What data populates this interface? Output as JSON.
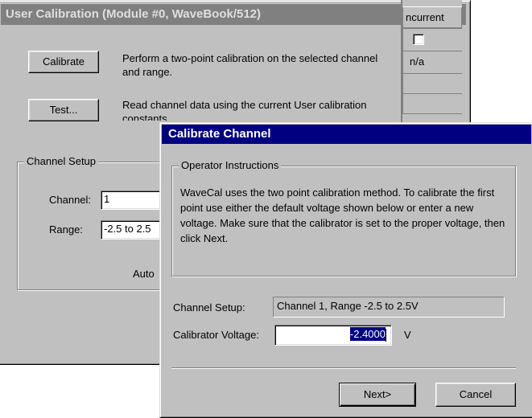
{
  "bg_window": {
    "title": "User Calibration (Module #0, WaveBook/512)",
    "calibrate_button": "Calibrate",
    "calibrate_desc": "Perform a two-point calibration on the selected channel and range.",
    "test_button": "Test...",
    "test_desc": "Read channel data using the current User calibration constants.",
    "channel_setup_title": "Channel Setup",
    "channel_label": "Channel:",
    "channel_value": "1",
    "range_label": "Range:",
    "range_value": "-2.5 to 2.5",
    "auto_label": "Auto",
    "table": {
      "header": "ncurrent",
      "row2_value": "n/a"
    }
  },
  "dialog": {
    "title": "Calibrate Channel",
    "group_title": "Operator Instructions",
    "instructions": "WaveCal uses the two point calibration method.  To calibrate the first point use either the default voltage shown below or enter a new voltage.  Make sure that the calibrator is set to the proper voltage, then click Next.",
    "channel_setup_label": "Channel Setup:",
    "channel_setup_value": "Channel 1,  Range -2.5 to 2.5V",
    "voltage_label": "Calibrator Voltage:",
    "voltage_value": "-2.4000",
    "voltage_unit": "V",
    "next_button": "Next>",
    "cancel_button": "Cancel"
  },
  "colors": {
    "window_face": "#c0c0c0",
    "active_title": "#000080",
    "inactive_title": "#808080",
    "selection": "#000080"
  }
}
